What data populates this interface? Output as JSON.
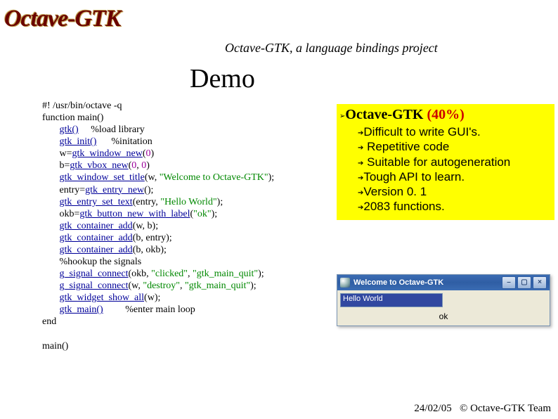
{
  "logo": "Octave-GTK",
  "subtitle": "Octave-GTK, a language bindings project",
  "heading": "Demo",
  "code": {
    "l0": "#! /usr/bin/octave -q",
    "l1": "function main()",
    "l2a": "gtk()",
    "l2b": "     %load library",
    "l3a": "gtk_init()",
    "l3b": "      %initation",
    "l4a": "w=",
    "l4b": "gtk_window_new",
    "l4c": "(",
    "l4d": "0",
    "l4e": ")",
    "l5a": "b=",
    "l5b": "gtk_vbox_new",
    "l5c": "(",
    "l5d": "0",
    "l5e": ", ",
    "l5f": "0",
    "l5g": ")",
    "l6a": "gtk_window_set_title",
    "l6b": "(w, ",
    "l6c": "\"Welcome to Octave-GTK\"",
    "l6d": ");",
    "l7a": "entry=",
    "l7b": "gtk_entry_new",
    "l7c": "();",
    "l8a": "gtk_entry_set_text",
    "l8b": "(entry, ",
    "l8c": "\"Hello World\"",
    "l8d": ");",
    "l9a": "okb=",
    "l9b": "gtk_button_new_with_label",
    "l9c": "(",
    "l9d": "\"ok\"",
    "l9e": ");",
    "l10a": "gtk_container_add",
    "l10b": "(w, b);",
    "l11a": "gtk_container_add",
    "l11b": "(b, entry);",
    "l12a": "gtk_container_add",
    "l12b": "(b, okb);",
    "l13": "%hookup the signals",
    "l14a": "g_signal_connect",
    "l14b": "(okb, ",
    "l14c": "\"clicked\"",
    "l14d": ", ",
    "l14e": "\"gtk_main_quit\"",
    "l14f": ");",
    "l15a": "g_signal_connect",
    "l15b": "(w, ",
    "l15c": "\"destroy\"",
    "l15d": ", ",
    "l15e": "\"gtk_main_quit\"",
    "l15f": ");",
    "l16a": "gtk_widget_show_all",
    "l16b": "(w);",
    "l17a": "gtk_main()",
    "l17b": "         %enter main loop",
    "l18": "end",
    "l19": "main()"
  },
  "highlight": {
    "title_a": "Octave-GTK",
    "title_b": " (40%)",
    "items": [
      "Difficult to write GUI's.",
      " Repetitive code",
      " Suitable for autogeneration",
      "Tough API to learn.",
      "Version 0. 1",
      "2083 functions."
    ]
  },
  "gui": {
    "title": "Welcome to Octave-GTK",
    "entry": "Hello World",
    "ok": "ok"
  },
  "footer": {
    "date": "24/02/05",
    "credit": "© Octave-GTK Team"
  }
}
